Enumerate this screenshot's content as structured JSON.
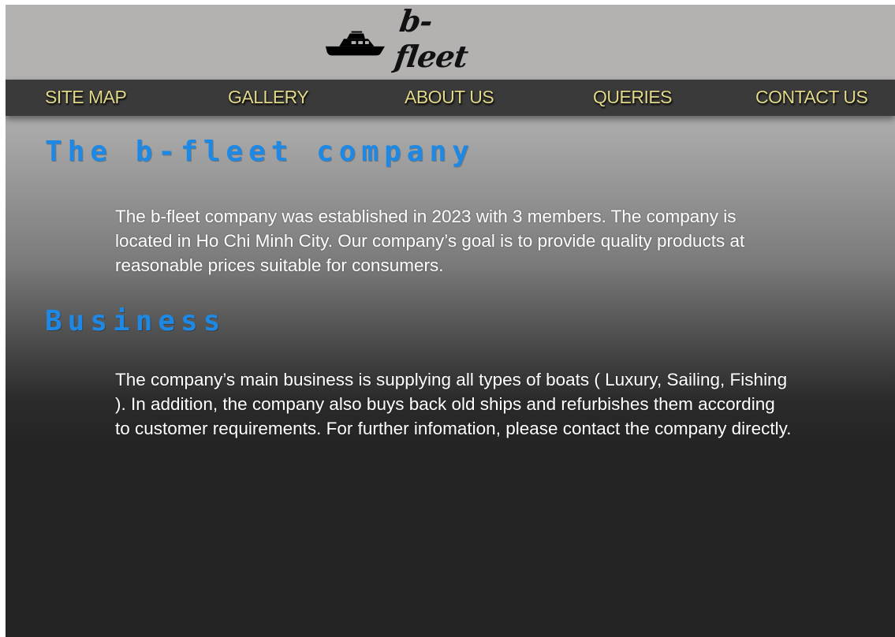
{
  "brand": {
    "name": "b-fleet",
    "logo_icon": "yacht-icon"
  },
  "nav": {
    "items": [
      {
        "label": "SITE MAP"
      },
      {
        "label": "GALLERY"
      },
      {
        "label": "ABOUT US"
      },
      {
        "label": "QUERIES"
      },
      {
        "label": "CONTACT US"
      }
    ],
    "text_color": "#e2d98a"
  },
  "sections": [
    {
      "title": "The b-fleet company",
      "body": "The b-fleet company was established in 2023 with 3 members. The company is located in Ho Chi Minh City. Our company’s goal is to provide quality products at reasonable prices suitable for consumers."
    },
    {
      "title": "Business",
      "body": "The company’s main business is supplying all types of boats ( Luxury, Sailing, Fishing ). In addition, the company also buys back old ships and refurbishes them according to customer requirements. For further infomation, please contact the company directly."
    }
  ],
  "colors": {
    "heading": "#1e88e5",
    "header_bg": "#b4b1b1",
    "nav_bg": "#3a3a3a",
    "body_text": "#ffffff"
  }
}
